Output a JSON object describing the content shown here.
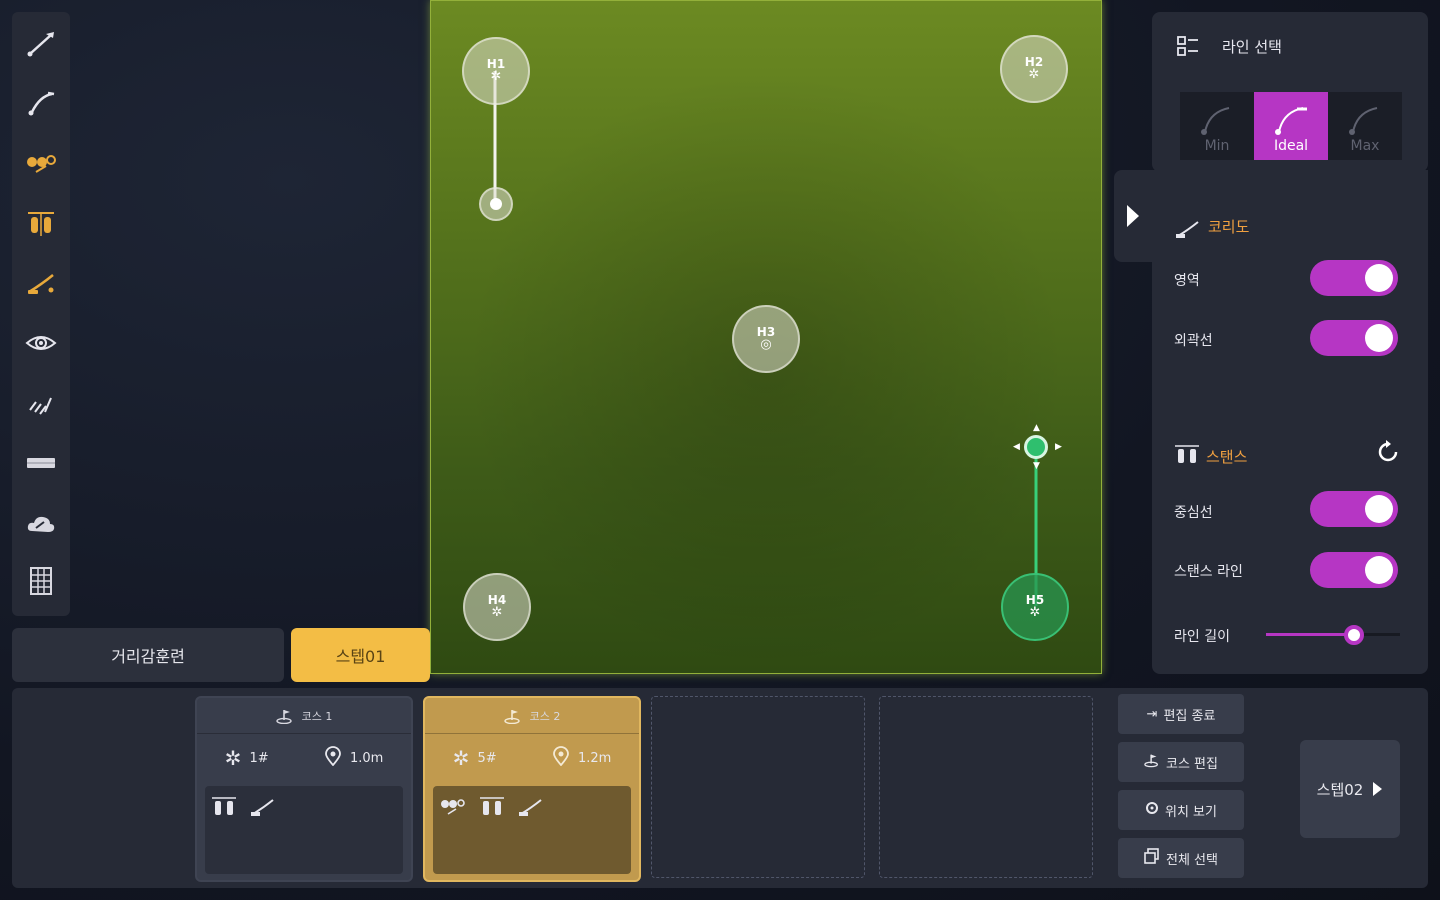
{
  "colors": {
    "accent_magenta": "#b636c4",
    "accent_gold": "#f3bd45",
    "accent_orange": "#f0a040",
    "active_hole_green": "#39c074"
  },
  "toolbar": {
    "icons": [
      "driver-club-icon",
      "iron-club-icon",
      "balls-icon",
      "stance-icon",
      "putter-icon",
      "eye-icon",
      "slope-lines-icon",
      "bar-icon",
      "cloud-icon",
      "grid-icon"
    ]
  },
  "field": {
    "holes": [
      {
        "label": "H1",
        "mark": "✲"
      },
      {
        "label": "H2",
        "mark": "✲"
      },
      {
        "label": "H3",
        "mark": "◎"
      },
      {
        "label": "H4",
        "mark": "✲"
      },
      {
        "label": "H5",
        "mark": "✲"
      }
    ]
  },
  "bottom_tabs": {
    "distance_label": "거리감훈련",
    "step_label": "스텝01"
  },
  "line_select": {
    "title": "라인 선택",
    "options": [
      "Min",
      "Ideal",
      "Max"
    ],
    "selected": "Ideal"
  },
  "settings": {
    "corridor_title": "코리도",
    "area_label": "영역",
    "outline_label": "외곽선",
    "stance_title": "스탠스",
    "center_line_label": "중심선",
    "stance_line_label": "스탠스 라인",
    "line_length_label": "라인 길이",
    "line_length_value": 0.66
  },
  "courses": [
    {
      "title": "코스 1",
      "holes": "1#",
      "distance": "1.0m"
    },
    {
      "title": "코스 2",
      "holes": "5#",
      "distance": "1.2m"
    }
  ],
  "actions": {
    "end_edit": "편집 종료",
    "course_edit": "코스 편집",
    "view_position": "위치 보기",
    "select_all": "전체 선택",
    "next_step": "스텝02"
  }
}
